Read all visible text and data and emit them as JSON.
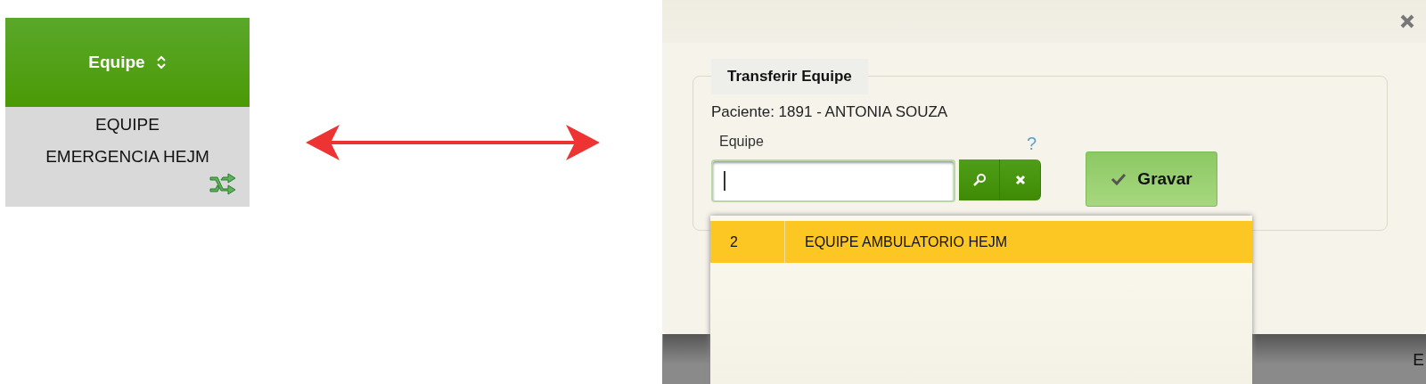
{
  "table": {
    "header": {
      "label": "Equipe"
    },
    "cell": {
      "lines": [
        "EQUIPE",
        "EMERGENCIA HEJM"
      ]
    }
  },
  "dialog": {
    "legend": "Transferir Equipe",
    "patient": "Paciente: 1891 - ANTONIA SOUZA",
    "field_label": "Equipe",
    "help": "?",
    "save_button": "Gravar",
    "dropdown": {
      "rows": [
        {
          "code": "2",
          "name": "EQUIPE AMBULATORIO HEJM",
          "selected": true
        }
      ]
    }
  },
  "background_table": {
    "cell_text": "E"
  }
}
